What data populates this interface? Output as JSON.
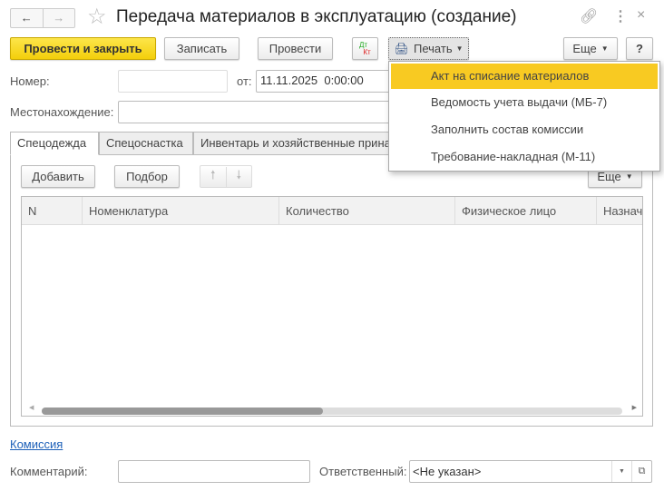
{
  "window": {
    "title": "Передача материалов в эксплуатацию (создание)"
  },
  "toolbar": {
    "post_close": "Провести и закрыть",
    "save": "Записать",
    "post": "Провести",
    "dt": "Дт",
    "kt": "Кт",
    "print": "Печать",
    "more": "Еще",
    "help": "?"
  },
  "print_menu": [
    "Акт на списание материалов",
    "Ведомость учета выдачи (МБ-7)",
    "Заполнить состав комиссии",
    "Требование-накладная (М-11)"
  ],
  "fields": {
    "number_label": "Номер:",
    "number_value": "",
    "date_label": "от:",
    "date_value": "11.11.2025  0:00:00",
    "location_label": "Местонахождение:",
    "location_value": ""
  },
  "tabs": [
    "Спецодежда",
    "Спецоснастка",
    "Инвентарь и хозяйственные принадлежности"
  ],
  "table_toolbar": {
    "add": "Добавить",
    "pick": "Подбор",
    "more": "Еще"
  },
  "table": {
    "columns": [
      "N",
      "Номенклатура",
      "Количество",
      "Физическое лицо",
      "Назначение"
    ],
    "rows": []
  },
  "footer": {
    "commission_link": "Комиссия",
    "comment_label": "Комментарий:",
    "comment_value": "",
    "responsible_label": "Ответственный:",
    "responsible_value": "<Не указан>"
  }
}
